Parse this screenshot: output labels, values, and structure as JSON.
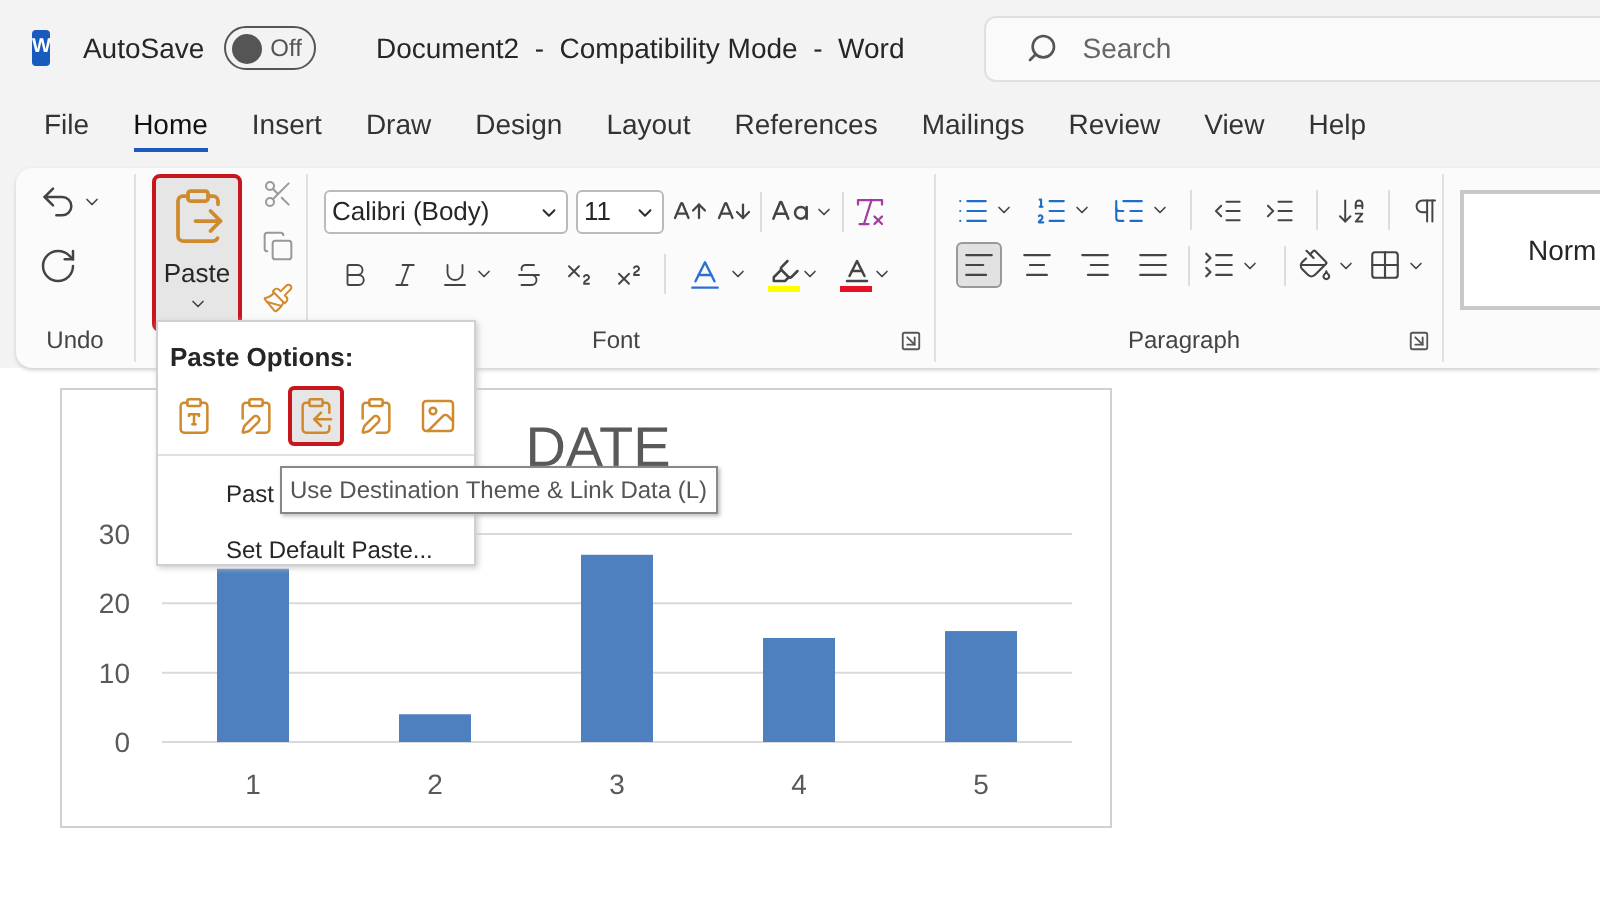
{
  "title_bar": {
    "logo_letter": "W",
    "autosave_label": "AutoSave",
    "autosave": {
      "on": false,
      "label": "Off"
    },
    "document_title": "Document2  -  Compatibility Mode  -  Word",
    "search": {
      "placeholder": "Search"
    }
  },
  "menu_tabs": [
    {
      "label": "File",
      "selected": false
    },
    {
      "label": "Home",
      "selected": true
    },
    {
      "label": "Insert",
      "selected": false
    },
    {
      "label": "Draw",
      "selected": false
    },
    {
      "label": "Design",
      "selected": false
    },
    {
      "label": "Layout",
      "selected": false
    },
    {
      "label": "References",
      "selected": false
    },
    {
      "label": "Mailings",
      "selected": false
    },
    {
      "label": "Review",
      "selected": false
    },
    {
      "label": "View",
      "selected": false
    },
    {
      "label": "Help",
      "selected": false
    }
  ],
  "ribbon": {
    "undo": {
      "label": "Undo"
    },
    "clipboard": {
      "paste_label": "Paste"
    },
    "font": {
      "font_name": "Calibri (Body)",
      "font_size": "11",
      "label": "Font"
    },
    "paragraph": {
      "label": "Paragraph",
      "alignment": [
        {
          "kind": "left",
          "selected": true
        },
        {
          "kind": "center",
          "selected": false
        },
        {
          "kind": "right",
          "selected": false
        },
        {
          "kind": "justify",
          "selected": false
        }
      ]
    },
    "styles": {
      "first_style": "Norm"
    }
  },
  "paste_menu": {
    "title": "Paste Options:",
    "options": [
      {
        "kind": "keep-source",
        "selected": false
      },
      {
        "kind": "dest-embed",
        "selected": false
      },
      {
        "kind": "dest-link",
        "selected": true
      },
      {
        "kind": "source-link",
        "selected": false
      },
      {
        "kind": "picture",
        "selected": false
      }
    ],
    "items": [
      "Past",
      "Set Default Paste..."
    ],
    "tooltip": "Use Destination Theme & Link Data (L)"
  },
  "chart": {
    "chart_data": {
      "type": "bar",
      "title": "DATE",
      "categories": [
        "1",
        "2",
        "3",
        "4",
        "5"
      ],
      "series": [
        {
          "color": "#4e7fbe",
          "values": [
            25,
            4,
            27,
            15,
            16
          ]
        }
      ],
      "ylim": [
        0,
        30
      ],
      "yticks": [
        0,
        10,
        20,
        30
      ]
    }
  }
}
